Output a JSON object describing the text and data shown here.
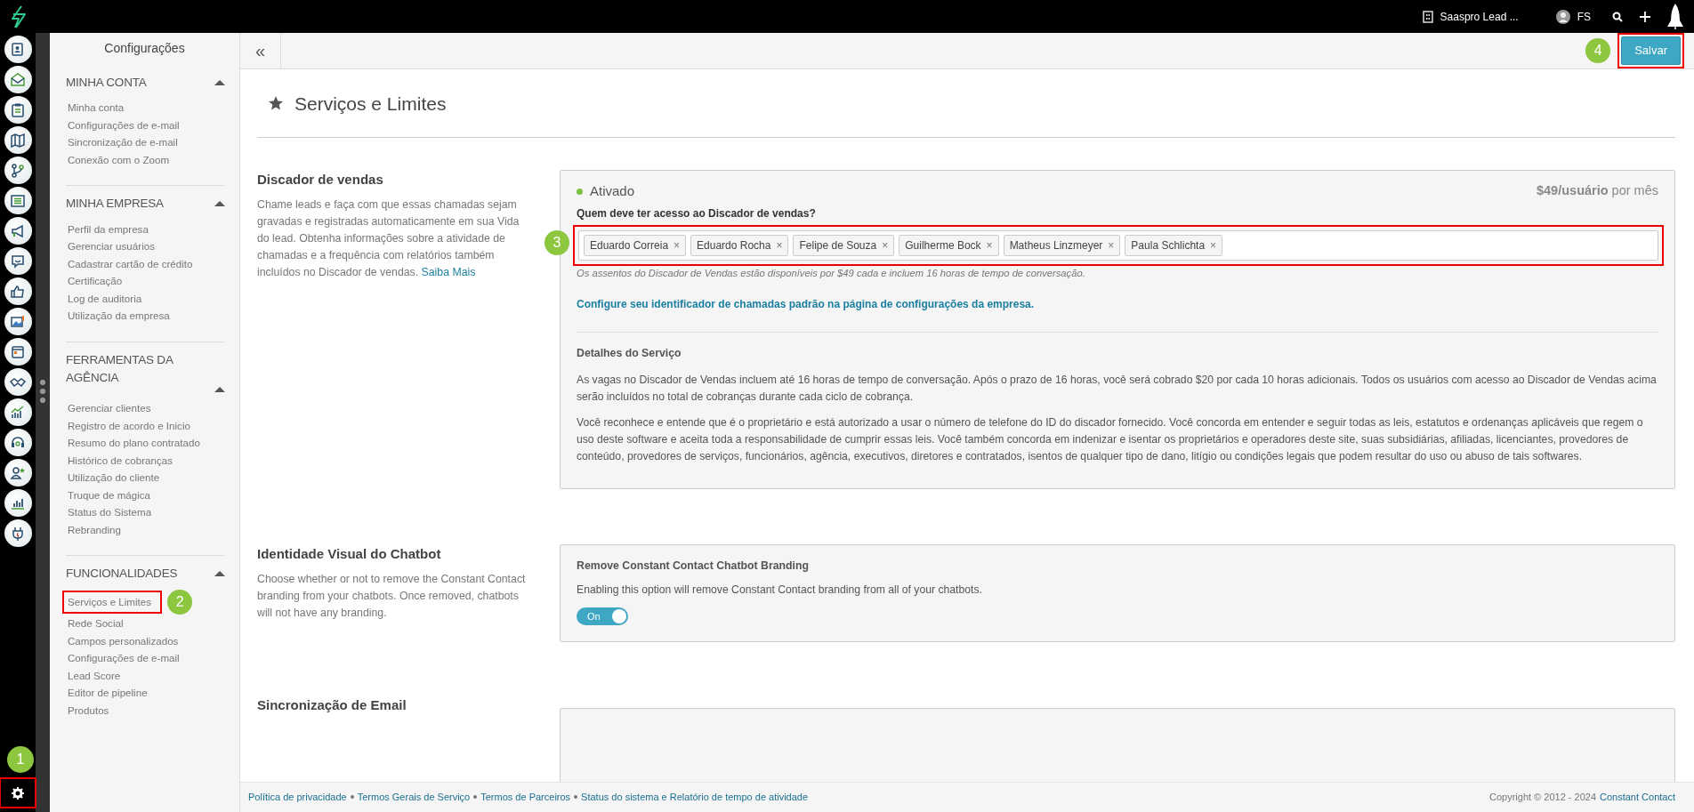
{
  "topbar": {
    "account": "Saaspro Lead ...",
    "user": "FS"
  },
  "rail": {
    "settings": {
      "highlighted": true,
      "callout": "1"
    }
  },
  "sidebar": {
    "title": "Configurações",
    "sections": [
      {
        "title": "MINHA CONTA",
        "expanded": true,
        "items": [
          {
            "label": "Minha conta",
            "highlighted": false
          },
          {
            "label": "Configurações de e-mail",
            "highlighted": false
          },
          {
            "label": "Sincronização de e-mail",
            "highlighted": false
          },
          {
            "label": "Conexão com o Zoom",
            "highlighted": false
          }
        ]
      },
      {
        "title": "MINHA EMPRESA",
        "expanded": true,
        "items": [
          {
            "label": "Perfil da empresa",
            "highlighted": false
          },
          {
            "label": "Gerenciar usuários",
            "highlighted": false
          },
          {
            "label": "Cadastrar cartão de crédito",
            "highlighted": false
          },
          {
            "label": "Certificação",
            "highlighted": false
          },
          {
            "label": "Log de auditoria",
            "highlighted": false
          },
          {
            "label": "Utilização da empresa",
            "highlighted": false
          }
        ]
      },
      {
        "title": "FERRAMENTAS DA AGÊNCIA",
        "expanded": true,
        "items": [
          {
            "label": "Gerenciar clientes",
            "highlighted": false
          },
          {
            "label": "Registro de acordo e Inicio",
            "highlighted": false
          },
          {
            "label": "Resumo do plano contratado",
            "highlighted": false
          },
          {
            "label": "Histórico de cobranças",
            "highlighted": false
          },
          {
            "label": "Utilização do cliente",
            "highlighted": false
          },
          {
            "label": "Truque de mágica",
            "highlighted": false
          },
          {
            "label": "Status do Sistema",
            "highlighted": false
          },
          {
            "label": "Rebranding",
            "highlighted": false
          }
        ]
      },
      {
        "title": "FUNCIONALIDADES",
        "expanded": true,
        "items": [
          {
            "label": "Serviços e Limites",
            "highlighted": true,
            "callout": "2"
          },
          {
            "label": "Rede Social",
            "highlighted": false
          },
          {
            "label": "Campos personalizados",
            "highlighted": false
          },
          {
            "label": "Configurações de e-mail",
            "highlighted": false
          },
          {
            "label": "Lead Score",
            "highlighted": false
          },
          {
            "label": "Editor de pipeline",
            "highlighted": false
          },
          {
            "label": "Produtos",
            "highlighted": false
          }
        ]
      }
    ]
  },
  "toolbar": {
    "collapse": "«",
    "save": {
      "label": "Salvar",
      "highlighted": true,
      "callout": "4"
    }
  },
  "page": {
    "title": "Serviços e Limites",
    "sections": [
      {
        "kind": "dialer",
        "heading": "Discador de vendas",
        "description": "Chame leads e faça com que essas chamadas sejam gravadas e registradas automaticamente em sua Vida do lead. Obtenha informações sobre a atividade de chamadas e a frequência com relatórios também incluídos no Discador de vendas.",
        "more_link": "Saiba Mais",
        "card": {
          "status": "Ativado",
          "active": true,
          "price": "**$49/usuário** por mês",
          "question": "Quem deve ter acesso ao Discador de vendas?",
          "tags_highlighted": true,
          "tags_callout": "3",
          "tags": [
            {
              "name": "Eduardo Correia",
              "remove": "×"
            },
            {
              "name": "Eduardo Rocha",
              "remove": "×"
            },
            {
              "name": "Felipe de Souza",
              "remove": "×"
            },
            {
              "name": "Guilherme Bock",
              "remove": "×"
            },
            {
              "name": "Matheus Linzmeyer",
              "remove": "×"
            },
            {
              "name": "Paula Schlichta",
              "remove": "×"
            }
          ],
          "note": "Os assentos do Discador de Vendas estão disponíveis por $49 cada e incluem 16 horas de tempo de conversação.",
          "config_link": "Configure seu identificador de chamadas padrão na página de configurações da empresa.",
          "details_title": "Detalhes do Serviço",
          "details": [
            "As vagas no Discador de Vendas incluem até 16 horas de tempo de conversação. Após o prazo de 16 horas, você será cobrado $20 por cada 10 horas adicionais. Todos os usuários com acesso ao Discador de Vendas acima serão incluídos no total de cobranças durante cada ciclo de cobrança.",
            "Você reconhece e entende que é o proprietário e está autorizado a usar o número de telefone do ID do discador fornecido. Você concorda em entender e seguir todas as leis, estatutos e ordenanças aplicáveis que regem o uso deste software e aceita toda a responsabilidade de cumprir essas leis. Você também concorda em indenizar e isentar os proprietários e operadores deste site, suas subsidiárias, afiliadas, licenciantes, provedores de conteúdo, provedores de serviços, funcionários, agência, executivos, diretores e contratados, isentos de qualquer tipo de dano, litígio ou condições legais que podem resultar do uso ou abuso de tais softwares."
          ]
        }
      },
      {
        "kind": "toggle",
        "heading": "Identidade Visual do Chatbot",
        "description": "Choose whether or not to remove the Constant Contact branding from your chatbots. Once removed, chatbots will not have any branding.",
        "card": {
          "title": "Remove Constant Contact Chatbot Branding",
          "text": "Enabling this option will remove Constant Contact branding from all of your chatbots.",
          "toggle": {
            "on": true,
            "label": "On"
          }
        }
      },
      {
        "kind": "empty",
        "heading": "Sincronização de Email"
      }
    ]
  },
  "footer": {
    "links": [
      "Política de privacidade",
      "Termos Gerais de Serviço",
      "Termos de Parceiros",
      "Status do sistema e Relatório de tempo de atividade"
    ],
    "copyright": "Copyright © 2012 - 2024",
    "company_link": "Constant Contact"
  }
}
